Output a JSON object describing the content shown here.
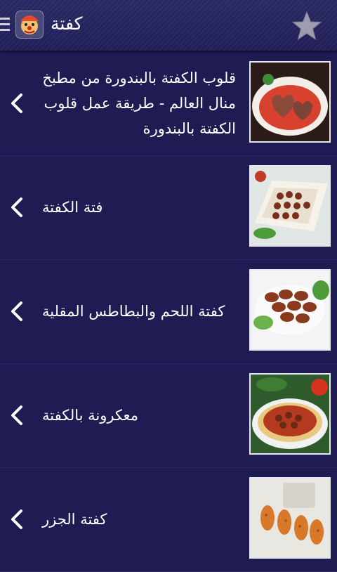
{
  "header": {
    "title": "كفتة",
    "menu_icon": "overflow-menu-icon",
    "app_icon": "clown-app-icon",
    "favorite_icon": "star-icon"
  },
  "list": [
    {
      "title": "قلوب الكفتة بالبندورة من مطبخ منال العالم - طريقة عمل قلوب الكفتة بالبندورة",
      "thumb": "heart-kofta-tomato"
    },
    {
      "title": "فتة الكفتة",
      "thumb": "kofta-fatteh"
    },
    {
      "title": "كفتة اللحم والبطاطس المقلية",
      "thumb": "meat-kofta-fries"
    },
    {
      "title": "معكرونة بالكفتة",
      "thumb": "pasta-kofta"
    },
    {
      "title": "كفتة الجزر",
      "thumb": "carrot-kofta"
    }
  ],
  "colors": {
    "background": "#1e1c52",
    "header": "#2a285f",
    "divider": "#2b2966",
    "text": "#ffffff"
  }
}
